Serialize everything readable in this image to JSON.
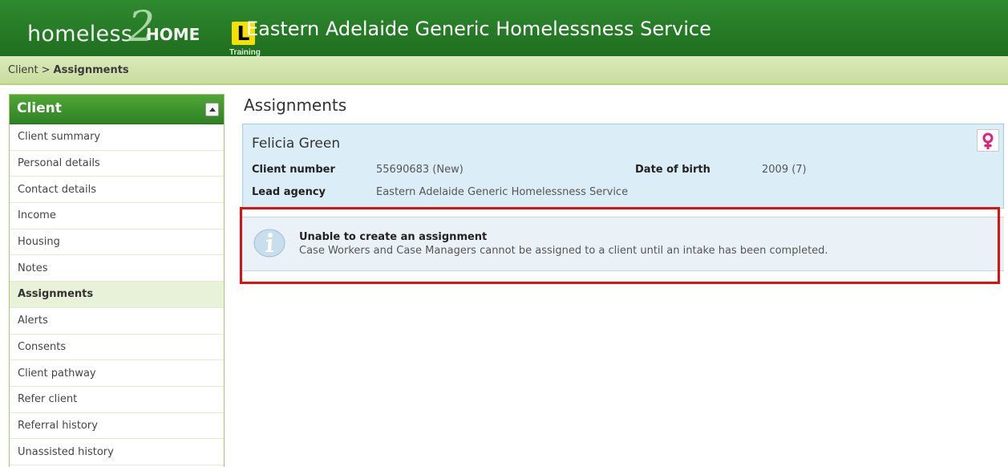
{
  "header": {
    "logo_text_homeless": "homeless",
    "logo_text_two": "2",
    "logo_text_home": "HOME",
    "learner_plate": "L",
    "training_label": "Training",
    "org_title": "Eastern Adelaide Generic Homelessness Service"
  },
  "breadcrumb": {
    "parent": "Client",
    "separator": ">",
    "current": "Assignments"
  },
  "sidebar": {
    "title": "Client",
    "items": [
      {
        "label": "Client summary"
      },
      {
        "label": "Personal details"
      },
      {
        "label": "Contact details"
      },
      {
        "label": "Income"
      },
      {
        "label": "Housing"
      },
      {
        "label": "Notes"
      },
      {
        "label": "Assignments",
        "active": true
      },
      {
        "label": "Alerts"
      },
      {
        "label": "Consents"
      },
      {
        "label": "Client pathway"
      },
      {
        "label": "Refer client"
      },
      {
        "label": "Referral history"
      },
      {
        "label": "Unassisted history"
      }
    ]
  },
  "main": {
    "page_title": "Assignments",
    "client": {
      "name": "Felicia Green",
      "gender_icon": "female-icon",
      "client_number_label": "Client number",
      "client_number_value": "55690683 (New)",
      "dob_label": "Date of birth",
      "dob_value": "2009 (7)",
      "lead_agency_label": "Lead agency",
      "lead_agency_value": "Eastern Adelaide Generic Homelessness Service"
    },
    "info": {
      "icon": "info-icon",
      "title": "Unable to create an assignment",
      "message": "Case Workers and Case Managers cannot be assigned to a client until an intake has been completed."
    }
  },
  "colors": {
    "header_green": "#2f8a2f",
    "breadcrumb_bg": "#d4e6ad",
    "card_bg": "#dbeef7",
    "highlight_border": "#e01010",
    "female_icon": "#e0207a"
  }
}
